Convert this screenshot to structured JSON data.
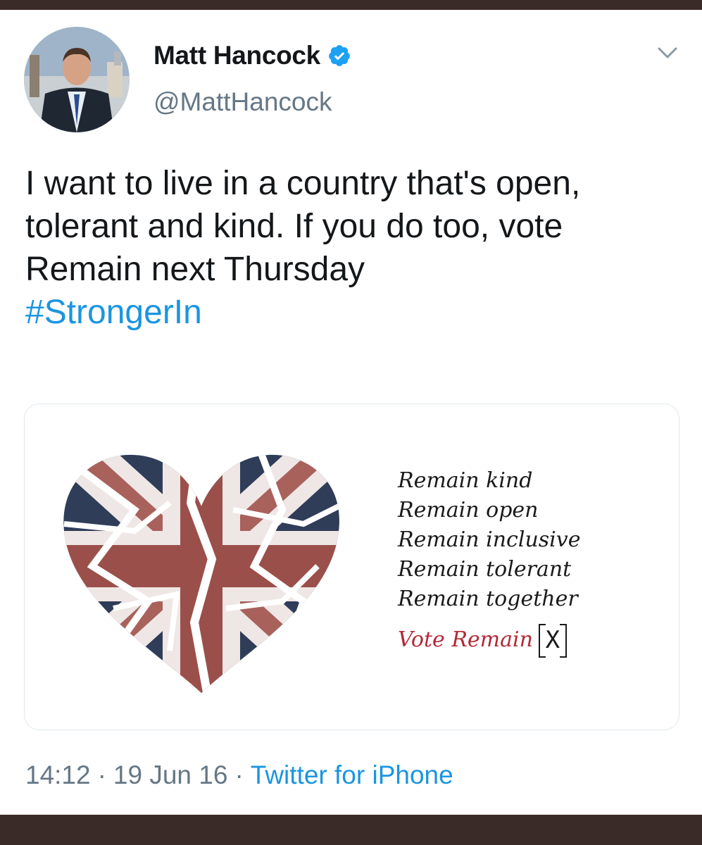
{
  "user": {
    "name": "Matt Hancock",
    "handle": "@MattHancock",
    "verified": true,
    "avatar": "profile-photo"
  },
  "tweet": {
    "text": "I want to live in a country that's open, tolerant and kind. If you do too, vote Remain next Thursday",
    "hashtag": "#StrongerIn"
  },
  "card": {
    "image": "torn-union-jack-heart",
    "lines": [
      "Remain kind",
      "Remain open",
      "Remain inclusive",
      "Remain tolerant",
      "Remain together"
    ],
    "vote_label": "Vote Remain",
    "vote_box": "X"
  },
  "meta": {
    "time": "14:12",
    "date": "19 Jun 16",
    "source": "Twitter for iPhone"
  },
  "colors": {
    "link": "#1b95e0",
    "secondary": "#657786",
    "vote": "#b22a36",
    "frame": "#3a2a28"
  },
  "icons": [
    "verified-badge-icon",
    "chevron-down-icon"
  ]
}
